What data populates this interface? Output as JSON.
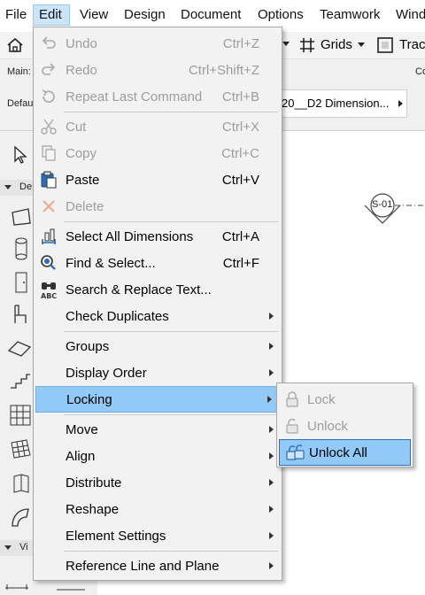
{
  "menubar": {
    "items": [
      "File",
      "Edit",
      "View",
      "Design",
      "Document",
      "Options",
      "Teamwork",
      "Wind"
    ]
  },
  "toolbar": {
    "grids_label": "Grids",
    "trace_label": "Trac"
  },
  "infobar": {
    "main_label": "Main:",
    "default_label": "Defau",
    "view_name": "20__D2 Dimension...",
    "right_label": "Co"
  },
  "leftpanel": {
    "design_label": "De",
    "view_label": "Vi"
  },
  "canvas": {
    "marker_label": "S-01"
  },
  "edit_menu": {
    "items": [
      {
        "label": "Undo",
        "shortcut": "Ctrl+Z",
        "icon": "undo-icon",
        "disabled": true
      },
      {
        "label": "Redo",
        "shortcut": "Ctrl+Shift+Z",
        "icon": "redo-icon",
        "disabled": true
      },
      {
        "label": "Repeat Last Command",
        "shortcut": "Ctrl+B",
        "icon": "repeat-icon",
        "disabled": true
      },
      {
        "label": "Cut",
        "shortcut": "Ctrl+X",
        "icon": "scissors-icon",
        "disabled": true
      },
      {
        "label": "Copy",
        "shortcut": "Ctrl+C",
        "icon": "copy-icon",
        "disabled": true
      },
      {
        "label": "Paste",
        "shortcut": "Ctrl+V",
        "icon": "paste-icon",
        "disabled": false
      },
      {
        "label": "Delete",
        "shortcut": "",
        "icon": "delete-x-icon",
        "disabled": true
      },
      {
        "label": "Select All Dimensions",
        "shortcut": "Ctrl+A",
        "icon": "select-all-dimensions-icon",
        "disabled": false
      },
      {
        "label": "Find & Select...",
        "shortcut": "Ctrl+F",
        "icon": "find-select-icon",
        "disabled": false
      },
      {
        "label": "Search & Replace Text...",
        "shortcut": "",
        "icon": "binoculars-abc-icon",
        "disabled": false
      },
      {
        "label": "Check Duplicates",
        "shortcut": "",
        "icon": "",
        "disabled": false
      },
      {
        "label": "Groups",
        "shortcut": "",
        "icon": "",
        "disabled": false
      },
      {
        "label": "Display Order",
        "shortcut": "",
        "icon": "",
        "disabled": false
      },
      {
        "label": "Locking",
        "shortcut": "",
        "icon": "",
        "disabled": false
      },
      {
        "label": "Move",
        "shortcut": "",
        "icon": "",
        "disabled": false
      },
      {
        "label": "Align",
        "shortcut": "",
        "icon": "",
        "disabled": false
      },
      {
        "label": "Distribute",
        "shortcut": "",
        "icon": "",
        "disabled": false
      },
      {
        "label": "Reshape",
        "shortcut": "",
        "icon": "",
        "disabled": false
      },
      {
        "label": "Element Settings",
        "shortcut": "",
        "icon": "",
        "disabled": false
      },
      {
        "label": "Reference Line and Plane",
        "shortcut": "",
        "icon": "",
        "disabled": false
      }
    ]
  },
  "locking_submenu": {
    "items": [
      {
        "label": "Lock",
        "icon": "lock-icon",
        "disabled": true
      },
      {
        "label": "Unlock",
        "icon": "unlock-icon",
        "disabled": true
      },
      {
        "label": "Unlock All",
        "icon": "unlock-all-icon",
        "disabled": false
      }
    ]
  },
  "colors": {
    "highlight": "#91c9f7",
    "menu_bg": "#f2f2f2",
    "disabled_text": "#9d9d9d"
  }
}
